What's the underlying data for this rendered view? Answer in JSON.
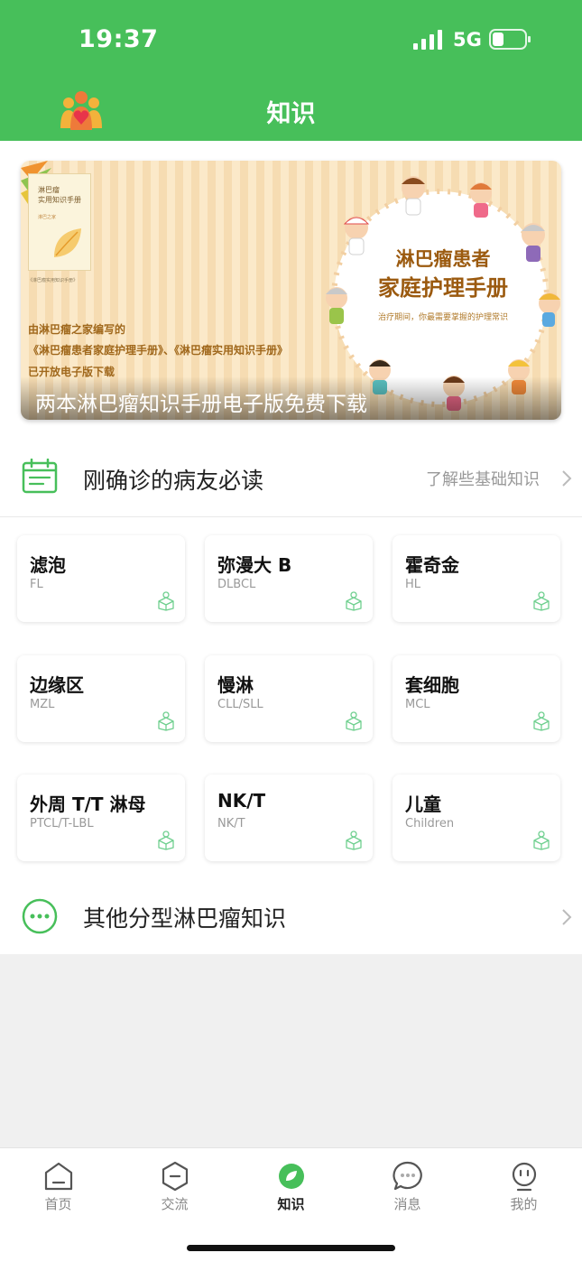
{
  "status_bar": {
    "time": "19:37",
    "network": "5G"
  },
  "header": {
    "title": "知识"
  },
  "banner": {
    "booklet_title": "淋巴瘤\n实用知识手册",
    "booklet_sub": "淋巴之家",
    "blurb": "《淋巴瘤实用知识手册》",
    "promo_line1": "由淋巴瘤之家编写的",
    "promo_line2": "《淋巴瘤患者家庭护理手册》、《淋巴瘤实用知识手册》",
    "promo_line3": "已开放电子版下载",
    "ring_title1": "淋巴瘤患者",
    "ring_title2": "家庭护理手册",
    "ring_sub": "治疗期间，你最需要掌握的护理常识",
    "caption": "两本淋巴瘤知识手册电子版免费下载"
  },
  "newly_diagnosed": {
    "title": "刚确诊的病友必读",
    "link": "了解些基础知识"
  },
  "cards": [
    {
      "name": "滤泡",
      "code": "FL"
    },
    {
      "name": "弥漫大 B",
      "code": "DLBCL"
    },
    {
      "name": "霍奇金",
      "code": "HL"
    },
    {
      "name": "边缘区",
      "code": "MZL"
    },
    {
      "name": "慢淋",
      "code": "CLL/SLL"
    },
    {
      "name": "套细胞",
      "code": "MCL"
    },
    {
      "name": "外周 T/T 淋母",
      "code": "PTCL/T-LBL"
    },
    {
      "name": "NK/T",
      "code": "NK/T"
    },
    {
      "name": "儿童",
      "code": "Children"
    }
  ],
  "other": {
    "title": "其他分型淋巴瘤知识"
  },
  "tabs": [
    {
      "label": "首页",
      "icon": "home-icon"
    },
    {
      "label": "交流",
      "icon": "chat-hex-icon"
    },
    {
      "label": "知识",
      "icon": "knowledge-leaf-icon"
    },
    {
      "label": "消息",
      "icon": "message-bubble-icon"
    },
    {
      "label": "我的",
      "icon": "profile-face-icon"
    }
  ],
  "colors": {
    "brand_green": "#47bf5a",
    "accent_card_icon": "#6fcf8f"
  }
}
